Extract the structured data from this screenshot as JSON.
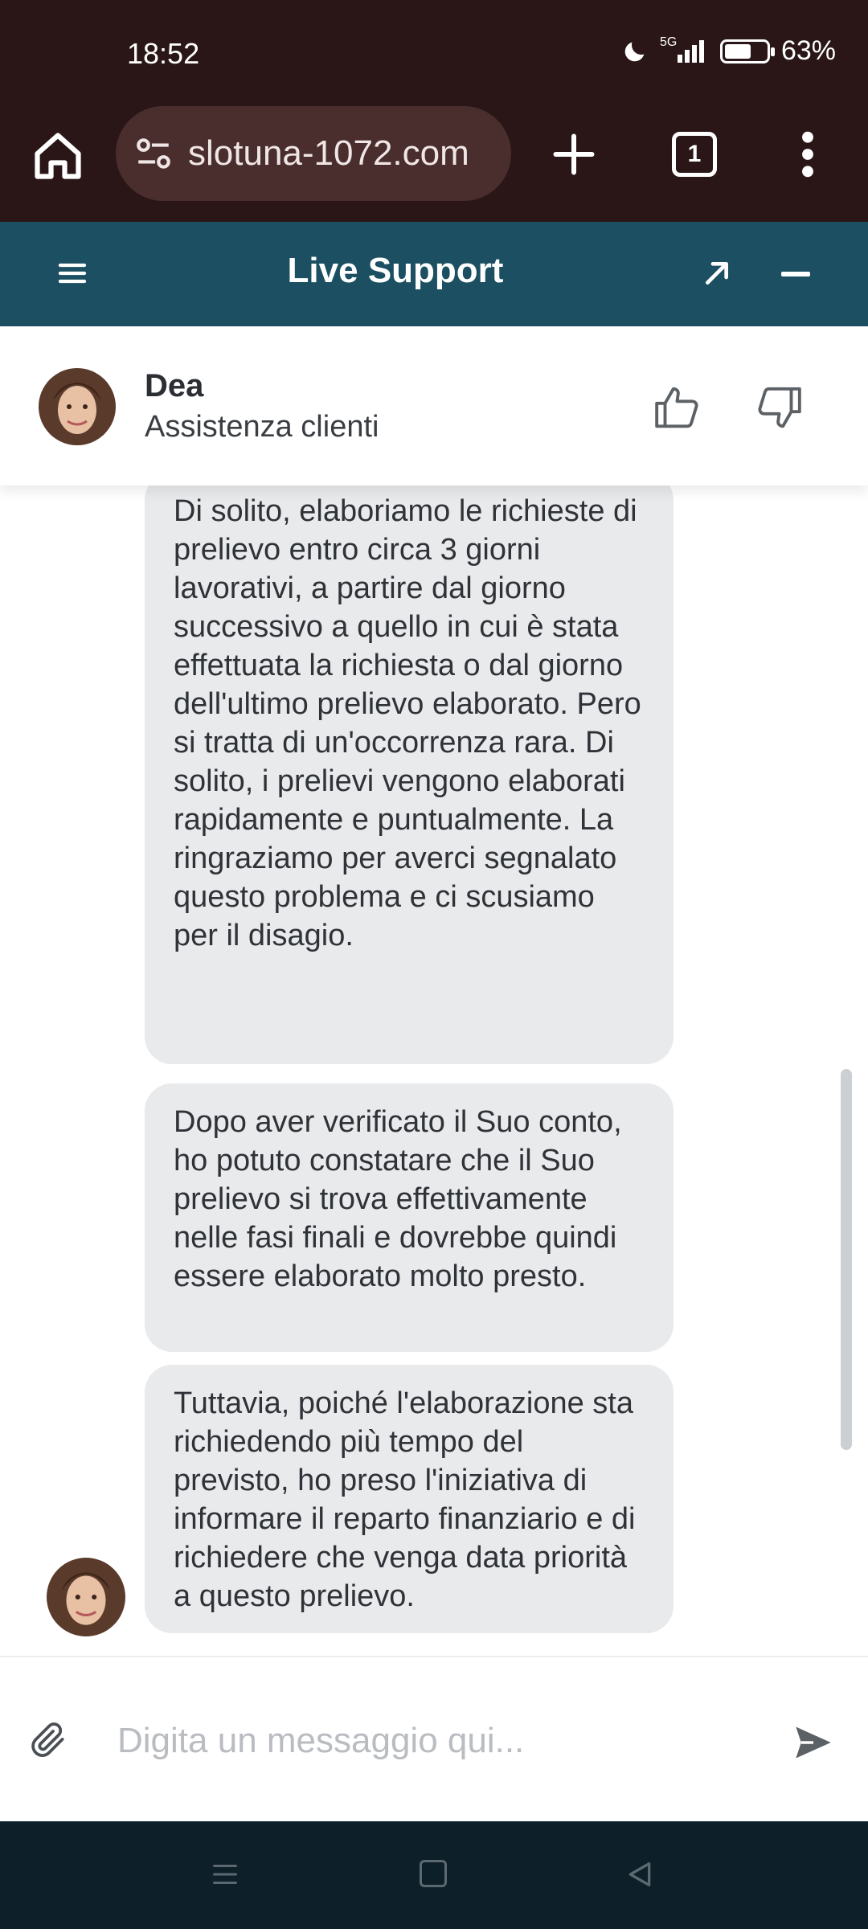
{
  "status_bar": {
    "time": "18:52",
    "network": "5G",
    "battery_percent": "63%",
    "battery_level": 0.63
  },
  "browser": {
    "url": "slotuna-1072.com",
    "tab_count": "1"
  },
  "support": {
    "title": "Live Support"
  },
  "agent": {
    "name": "Dea",
    "role": "Assistenza clienti"
  },
  "messages": [
    {
      "sender": "agent",
      "text": "Di solito, elaboriamo le richieste di prelievo entro circa 3 giorni lavorativi, a partire dal giorno successivo a quello in cui è stata effettuata la richiesta o dal giorno dell'ultimo prelievo elaborato. Pero si tratta di un'occorrenza rara. Di solito, i prelievi vengono elaborati rapidamente e puntualmente. La ringraziamo per averci segnalato questo problema e ci scusiamo per il disagio."
    },
    {
      "sender": "agent",
      "text": "Dopo aver verificato il Suo conto, ho potuto constatare che il Suo prelievo si trova effettivamente nelle fasi finali e dovrebbe quindi essere elaborato molto presto."
    },
    {
      "sender": "agent",
      "text": "Tuttavia, poiché l'elaborazione sta richiedendo più tempo del previsto, ho preso l'iniziativa di informare il reparto finanziario e di richiedere che venga data priorità a questo prelievo."
    }
  ],
  "composer": {
    "placeholder": "Digita un messaggio qui..."
  },
  "icons": {
    "home": "home-icon",
    "site_settings": "tune-icon",
    "new_tab": "plus-icon",
    "menu": "more-vert-icon",
    "support_menu": "hamburger-icon",
    "expand": "arrow-up-right-icon",
    "minimize": "minus-icon",
    "thumb_up": "thumb-up-icon",
    "thumb_down": "thumb-down-icon",
    "attach": "paperclip-icon",
    "send": "send-icon"
  },
  "colors": {
    "browser_bg": "#2a1616",
    "support_header_bg": "#1b4f61",
    "bubble_bg": "#e9eaec",
    "nav_bar_bg": "#0d1f29"
  }
}
